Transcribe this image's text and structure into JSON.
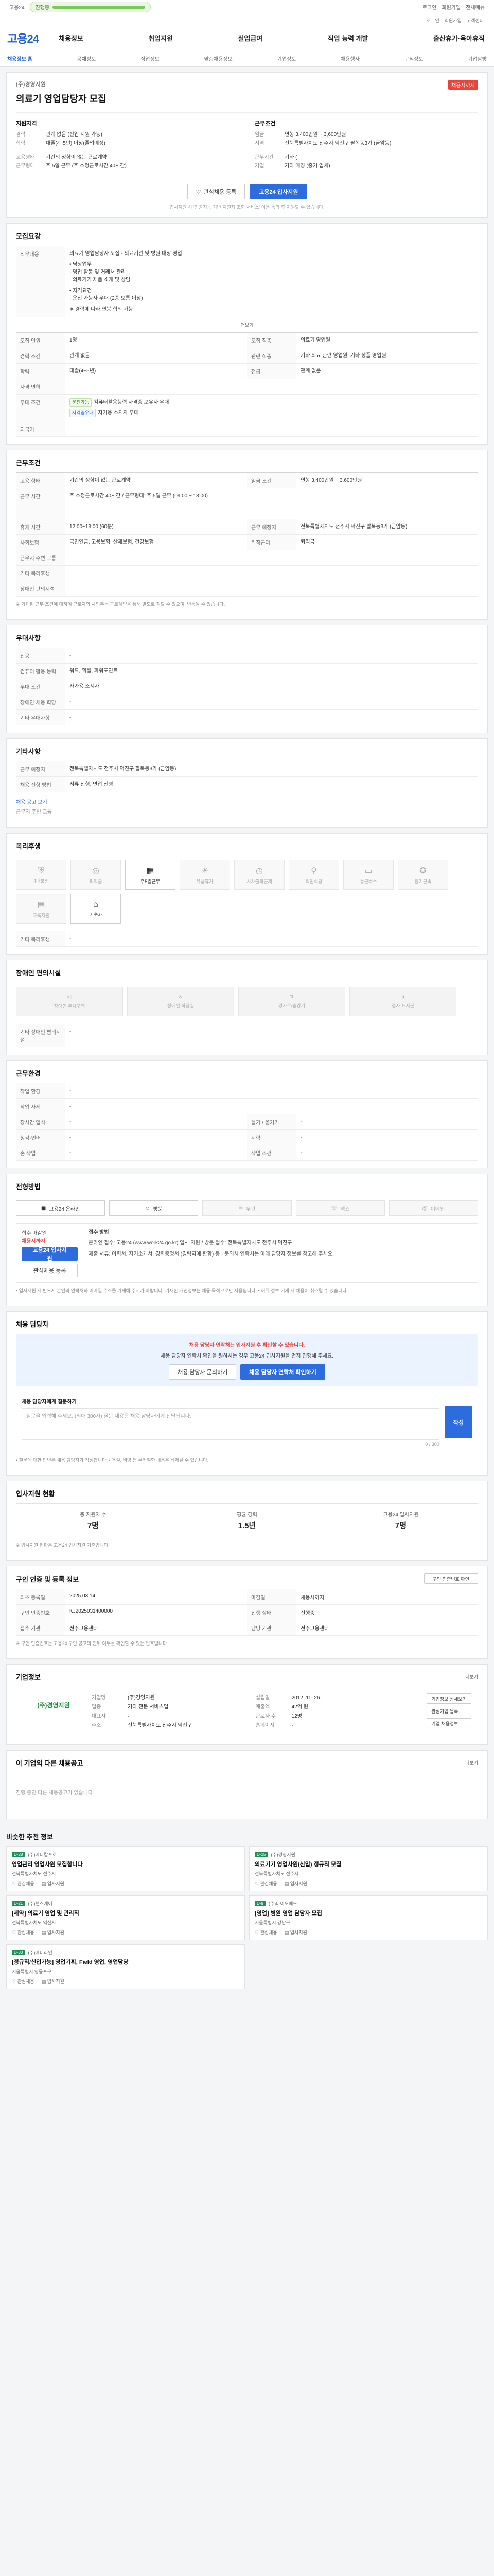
{
  "top": {
    "app": "고용24",
    "progress_label": "진행중",
    "links": [
      "로그인",
      "회원가입",
      "전체메뉴"
    ]
  },
  "util": {
    "items": [
      "로그인",
      "회원가입",
      "고객센터"
    ]
  },
  "gnb": {
    "logo": "고용24",
    "menu": [
      "채용정보",
      "취업지원",
      "실업급여",
      "직업 능력 개발",
      "출산휴가·육아휴직"
    ]
  },
  "subnav": {
    "items": [
      "채용정보 홈",
      "공채정보",
      "직업정보",
      "맞춤채용정보",
      "기업정보",
      "채용행사",
      "구직정보",
      "기업탐방"
    ],
    "active": 0
  },
  "job": {
    "company": "(주)경영지원",
    "deadline_badge": "채용시까지",
    "title": "의료기 영업담당자 모집",
    "recruit_head": "지원자격",
    "recruit": [
      [
        "경력",
        "관계 없음 (신입 지원 가능)"
      ],
      [
        "학력",
        "대졸(4~5년) 이상(졸업예정)"
      ],
      [
        "고용형태",
        "기간의 정함이 없는 근로계약"
      ],
      [
        "근무형태",
        "주 5일 근무 (주 소정근로시간 40시간)"
      ]
    ],
    "work_head": "근무조건",
    "work": [
      [
        "임금",
        "연봉 3,400만원 ~ 3,600만원"
      ],
      [
        "지역",
        "전북특별자치도 전주시 덕진구 팔복동3가 (금암동)"
      ],
      [
        "사업장명",
        ""
      ],
      [
        "근무기간",
        "기타 ("
      ],
      [
        "기업",
        "기타 매칭 (중기 업체)"
      ]
    ],
    "scrap_btn": "관심채용 등록",
    "apply_btn": "고용24 입사지원",
    "apply_note": "입사지원 시 '인공지능 기반 지원자 조회 서비스' 이용 동의 후 지원할 수 있습니다."
  },
  "jobinfo": {
    "title": "모집요강",
    "content_label": "직무내용",
    "content": "의료기 영업담당자 모집 - 의료기관 및 병원 대상 영업",
    "bullets": [
      "• 담당업무",
      "· 영업 활동 및 거래처 관리",
      "· 의료기기 제품 소개 및 상담",
      "• 자격요건",
      "· 운전 가능자 우대 (2종 보통 이상)"
    ],
    "salary_note": "※ 경력에 따라 연봉 협의 가능",
    "more": "더보기",
    "rows": [
      [
        "모집 인원",
        "1명",
        "모집 직종",
        "의료기 영업원"
      ],
      [
        "경력 조건",
        "관계 없음",
        "관련 직종",
        "기타 의료 관련 영업원, 기타 상품 영업원"
      ],
      [
        "학력",
        "대졸(4~5년)",
        "전공",
        "관계 없음"
      ],
      [
        "자격 면허",
        "",
        "",
        ""
      ],
      [
        "우대 조건",
        "컴퓨터활용능력 자격증 보유자 우대",
        "",
        ""
      ],
      [
        "외국어",
        "",
        "",
        ""
      ]
    ],
    "pref_tags": [
      "운전가능",
      "자격증우대"
    ],
    "pref_text": "자가용 소지자 우대"
  },
  "work": {
    "title": "근무조건",
    "rows": [
      [
        "고용 형태",
        "기간의 정함이 없는 근로계약",
        "임금 조건",
        "연봉 3,400만원 ~ 3,600만원"
      ],
      [
        "근무 시간",
        "주 소정근로시간 40시간 / 근무형태: 주 5일 근무 (09:00 ~ 18:00)",
        "",
        ""
      ],
      [
        "휴게 시간",
        "12:00~13:00 (60분)",
        "근무 예정지",
        "전북특별자치도 전주시 덕진구 팔복동3가 (금암동)"
      ],
      [
        "사회보험",
        "국민연금, 고용보험, 산재보험, 건강보험",
        "퇴직급여",
        "퇴직금"
      ],
      [
        "근무지 주변 교통",
        "",
        "",
        ""
      ],
      [
        "기타 복리후생",
        "",
        "",
        ""
      ],
      [
        "장애인 편의시설",
        "",
        "",
        ""
      ]
    ],
    "note": "※ 기재된 근무 조건에 대하여 근로자와 사업주는 근로계약을 통해 별도로 정할 수 있으며, 변동될 수 있습니다."
  },
  "workplace": {
    "title": "우대사항",
    "rows": [
      [
        "전공",
        "-"
      ],
      [
        "컴퓨터 활용 능력",
        "워드, 엑셀, 파워포인트"
      ],
      [
        "우대 조건",
        "자가용 소지자"
      ],
      [
        "장애인 채용 희망",
        "-"
      ],
      [
        "기타 우대사항",
        "-"
      ]
    ]
  },
  "etc": {
    "title": "기타사항",
    "rows": [
      [
        "근무 예정지",
        "전북특별자치도 전주시 덕진구 팔복동3가 (금암동)"
      ],
      [
        "채용 전형 방법",
        "서류 전형, 면접 전형"
      ]
    ],
    "link": "채용 공고 보기",
    "sub": "근무지 주변 교통"
  },
  "welfare": {
    "title": "복리후생",
    "items": [
      "4대보험",
      "퇴직금",
      "주5일근무",
      "유급휴가",
      "시차출퇴근제",
      "직원식당",
      "통근버스",
      "장기근속",
      "교육지원",
      "기숙사"
    ],
    "active": [
      2,
      9
    ],
    "etc_title": "기타 복리후생",
    "etc_value": "-"
  },
  "facility": {
    "title": "장애인 편의시설",
    "items": [
      "장애인 주차구역",
      "장애인 화장실",
      "경사로/승강기",
      "점자 표지판"
    ],
    "etc_title": "기타 장애인 편의시설",
    "etc_value": "-"
  },
  "env": {
    "title": "근무환경",
    "rows": [
      [
        "작업 환경",
        "-",
        "",
        ""
      ],
      [
        "작업 자세",
        "-",
        "",
        ""
      ],
      [
        "장시간 입식",
        "-",
        "들기 / 옮기기",
        "-"
      ],
      [
        "청각·언어",
        "-",
        "시력",
        "-"
      ],
      [
        "손 작업",
        "-",
        "작업 조건",
        "-"
      ]
    ]
  },
  "apply": {
    "title": "전형방법",
    "methods": [
      "고용24 온라인",
      "방문",
      "우편",
      "팩스",
      "이메일"
    ],
    "methods_active": [
      0,
      1
    ],
    "period_label": "접수 마감일",
    "period": "채용시까지",
    "apply_btn": "고용24 입사지원",
    "sub_btn": "관심채용 등록",
    "method_label": "접수 방법",
    "method_text": "온라인 접수: 고용24 (www.work24.go.kr) 입사 지원 / 방문 접수: 전북특별자치도 전주시 덕진구",
    "method_text2": "제출 서류: 이력서, 자기소개서, 경력증명서 (경력자에 한함) 등 · 문의처 연락처는 아래 담당자 정보를 참고해 주세요.",
    "notes": "• 입사지원 시 반드시 본인의 연락처와 이메일 주소를 기재해 주시기 바랍니다. 기재한 개인정보는 채용 목적으로만 사용됩니다. • 허위 정보 기재 시 채용이 취소될 수 있습니다."
  },
  "contact": {
    "title": "채용 담당자",
    "banner_hl": "채용 담당자 연락처는 입사지원 후 확인할 수 있습니다.",
    "banner_text": "채용 담당자 연락처 확인을 원하시는 경우 고용24 입사지원을 먼저 진행해 주세요.",
    "btn1": "채용 담당자 문의하기",
    "btn2": "채용 담당자 연락처 확인하기",
    "qna_title": "채용 담당자에게 질문하기",
    "qna_placeholder": "질문을 입력해 주세요. (최대 300자) 질문 내용은 채용 담당자에게 전달됩니다.",
    "qna_btn": "작성",
    "qna_count": "0 / 300",
    "notes": "• 질문에 대한 답변은 채용 담당자가 작성합니다. • 욕설, 비방 등 부적절한 내용은 삭제될 수 있습니다."
  },
  "stats": {
    "title": "입사지원 현황",
    "items": [
      [
        "총 지원자 수",
        "7명"
      ],
      [
        "평균 경력",
        "1.5년"
      ],
      [
        "고용24 입사지원",
        "7명"
      ]
    ],
    "note": "※ 입사지원 현황은 고용24 입사지원 기준입니다."
  },
  "reg": {
    "title": "구인 인증 및 등록 정보",
    "btn": "구인 인증번호 확인",
    "rows": [
      [
        "최초 등록일",
        "2025.03.14",
        "마감일",
        "채용시까지"
      ],
      [
        "구인 인증번호",
        "KJ2025031400000",
        "진행 상태",
        "진행중"
      ],
      [
        "접수 기관",
        "전주고용센터",
        "담당 기관",
        "전주고용센터"
      ]
    ],
    "note": "※ 구인 인증번호는 고용24 구인 공고의 진위 여부를 확인할 수 있는 번호입니다."
  },
  "company": {
    "title": "기업정보",
    "more": "더보기",
    "logo": "(주)경영지원",
    "rows": [
      [
        "기업명",
        "(주)경영지원",
        "설립일",
        "2012. 11. 26."
      ],
      [
        "업종",
        "기타 전문 서비스업",
        "매출액",
        "42억 원"
      ],
      [
        "대표자",
        "-",
        "근로자 수",
        "12명"
      ],
      [
        "주소",
        "전북특별자치도 전주시 덕진구",
        "홈페이지",
        "-"
      ]
    ],
    "btns": [
      "기업정보 상세보기",
      "관심기업 등록",
      "기업 채용정보"
    ]
  },
  "same": {
    "title": "이 기업의 다른 채용공고",
    "empty": "진행 중인 다른 채용공고가 없습니다.",
    "more": "더보기"
  },
  "recommend": {
    "title": "비슷한 추천 정보",
    "items": [
      {
        "dday": "D-28",
        "company": "(주)메디칼프로",
        "title": "영업관리 영업사원 모집합니다",
        "loc": "전북특별자치도 전주시",
        "s1": "관심채용",
        "s2": "입사지원"
      },
      {
        "dday": "D-15",
        "company": "(주)경영지원",
        "title": "의료기기 영업사원(신입) 정규직 모집",
        "loc": "전북특별자치도 전주시",
        "s1": "관심채용",
        "s2": "입사지원"
      },
      {
        "dday": "D-21",
        "company": "(주)헬스케어",
        "title": "[제약] 의료기 영업 및 관리직",
        "loc": "전북특별자치도 익산시",
        "s1": "관심채용",
        "s2": "입사지원"
      },
      {
        "dday": "D-9",
        "company": "(주)바이오메드",
        "title": "[영업] 병원 영업 담당자 모집",
        "loc": "서울특별시 강남구",
        "s1": "관심채용",
        "s2": "입사지원"
      },
      {
        "dday": "D-30",
        "company": "(주)메디라인",
        "title": "[정규직/신입가능] 영업기획, Field 영업, 영업담당",
        "loc": "서울특별시 영등포구",
        "s1": "관심채용",
        "s2": "입사지원"
      }
    ]
  }
}
